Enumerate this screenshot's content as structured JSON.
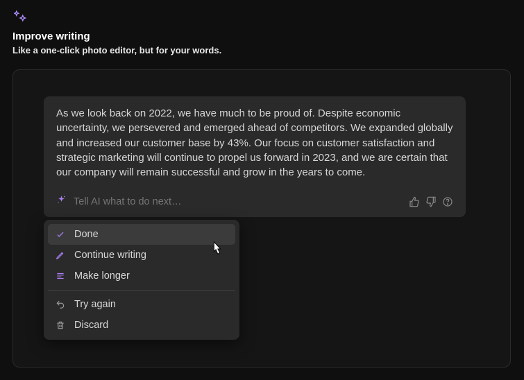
{
  "header": {
    "title": "Improve writing",
    "subtitle": "Like a one-click photo editor, but for your words."
  },
  "ai": {
    "output": "As we look back on 2022, we have much to be proud of. Despite economic uncertainty, we persevered and emerged ahead of competitors. We expanded globally and increased our customer base by 43%. Our focus on customer satisfaction and strategic marketing will continue to propel us forward in 2023, and we are certain that our company will remain successful and grow in the years to come.",
    "placeholder": "Tell AI what to do next…"
  },
  "menu": {
    "items": [
      {
        "label": "Done"
      },
      {
        "label": "Continue writing"
      },
      {
        "label": "Make longer"
      },
      {
        "label": "Try again"
      },
      {
        "label": "Discard"
      }
    ]
  }
}
